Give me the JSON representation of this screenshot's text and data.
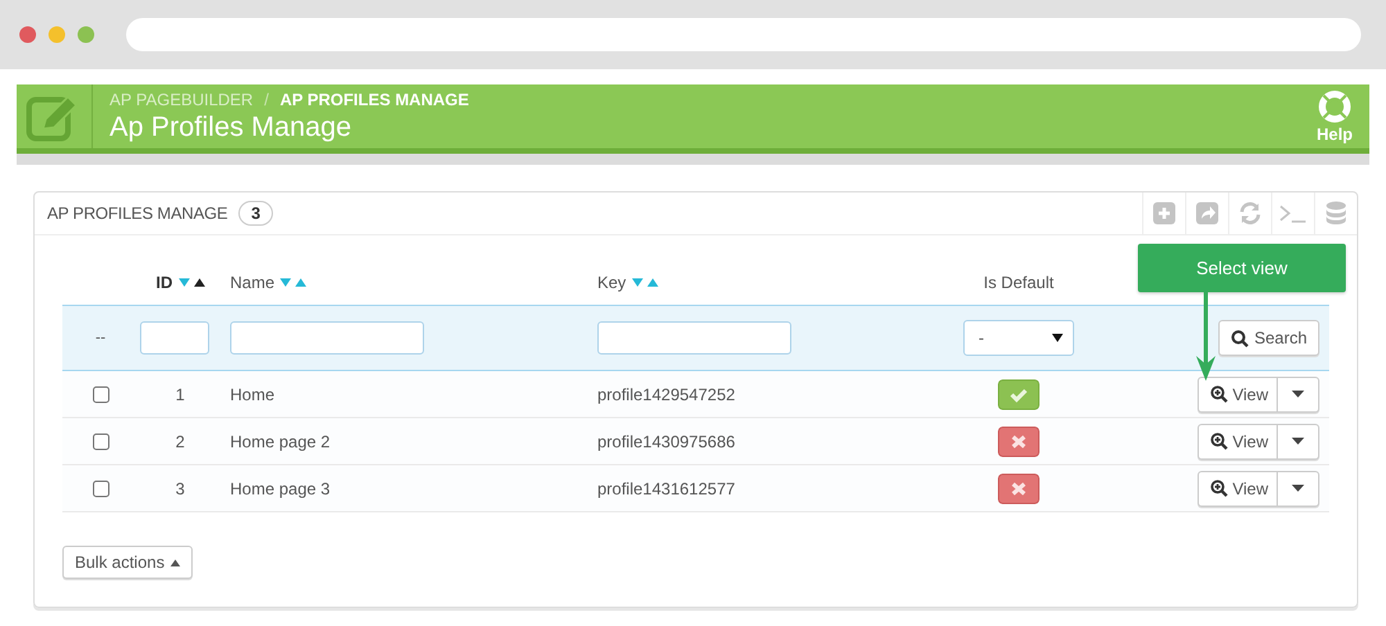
{
  "header": {
    "breadcrumbs": [
      {
        "label": "AP PAGEBUILDER",
        "current": false
      },
      {
        "label": "AP PROFILES MANAGE",
        "current": true
      }
    ],
    "separator": "/",
    "title": "Ap Profiles Manage",
    "help": "Help"
  },
  "panel": {
    "title": "AP PROFILES MANAGE",
    "count": "3"
  },
  "table": {
    "columns": [
      {
        "label": "ID",
        "sorted_ascending": true
      },
      {
        "label": "Name",
        "sorted_ascending": false
      },
      {
        "label": "Key",
        "sorted_ascending": false
      },
      {
        "label": "Is Default"
      }
    ],
    "filter": {
      "marker": "--",
      "select_value": "-",
      "search_label": "Search"
    },
    "rows": [
      {
        "selected": false,
        "id": "1",
        "name": "Home",
        "key": "profile1429547252",
        "is_default": true,
        "action": "View"
      },
      {
        "selected": false,
        "id": "2",
        "name": "Home page 2",
        "key": "profile1430975686",
        "is_default": false,
        "action": "View"
      },
      {
        "selected": false,
        "id": "3",
        "name": "Home page 3",
        "key": "profile1431612577",
        "is_default": false,
        "action": "View"
      }
    ]
  },
  "bulk_actions": "Bulk actions",
  "tooltip": "Select view"
}
